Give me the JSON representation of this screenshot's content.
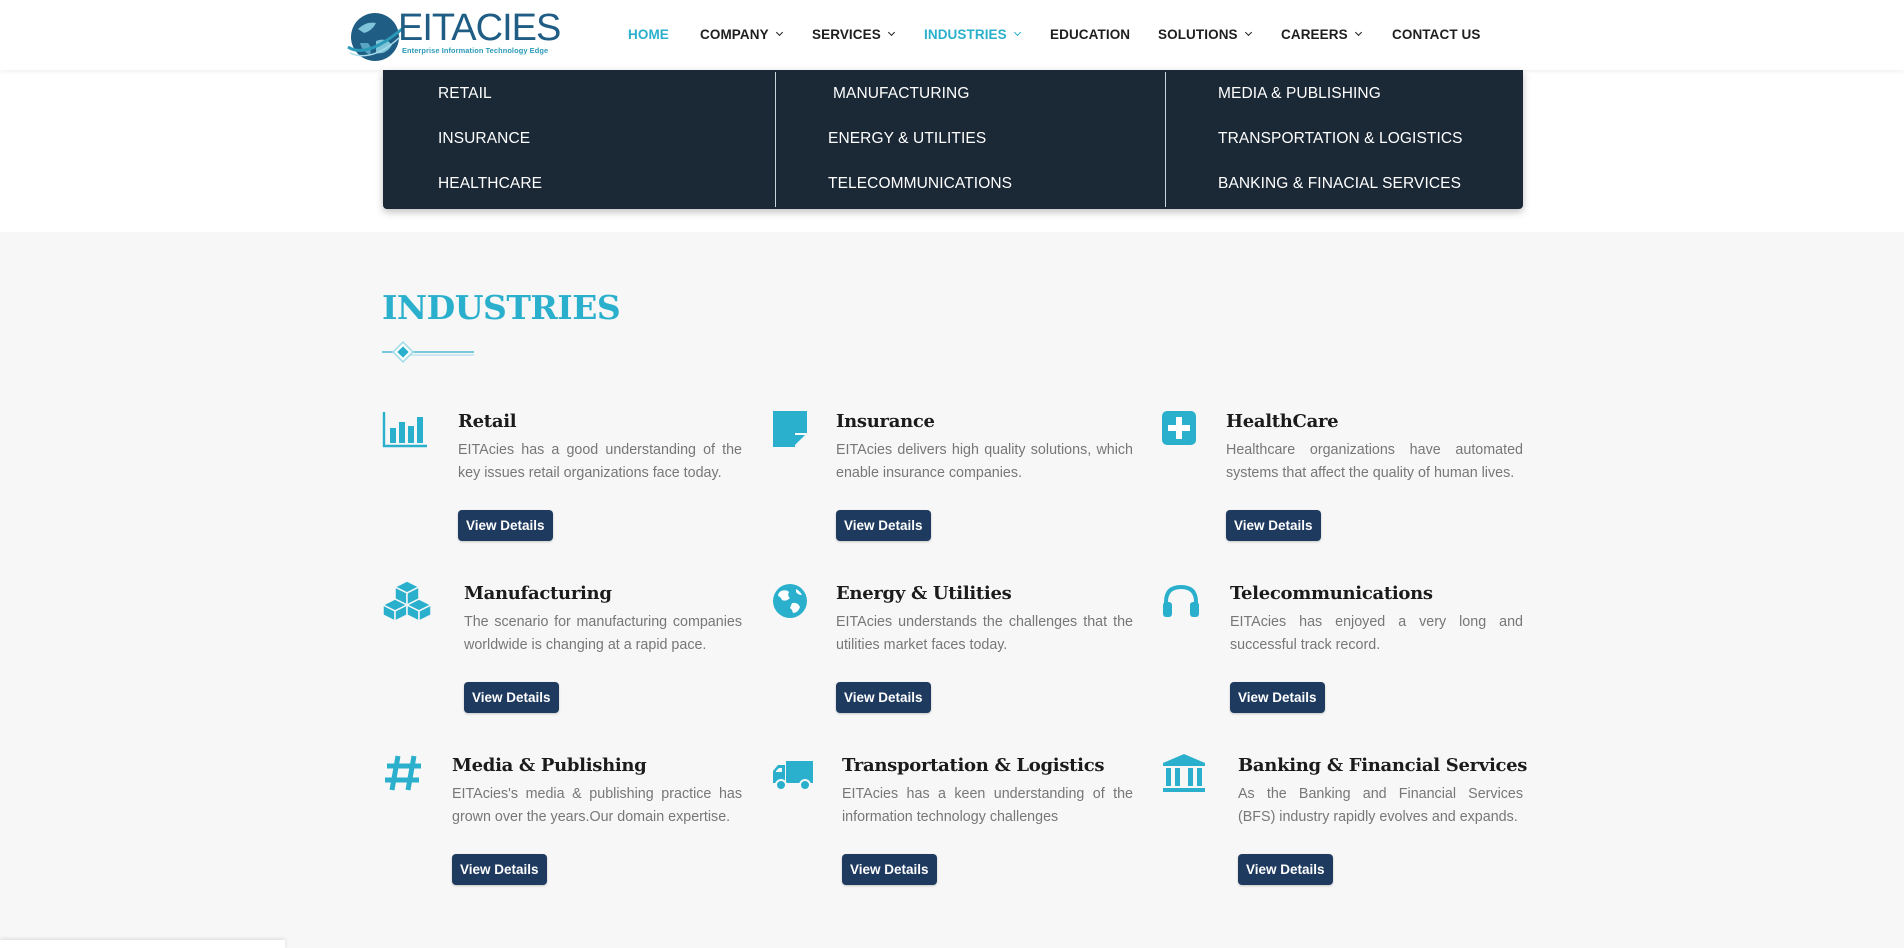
{
  "brand": {
    "name": "EITACIES",
    "tagline": "Enterprise Information Technology Edge",
    "accent_color": "#2ab0cc",
    "navy_color": "#1e3a5f"
  },
  "nav": {
    "items": [
      {
        "label": "HOME",
        "active": true,
        "has_dropdown": false
      },
      {
        "label": "COMPANY",
        "active": false,
        "has_dropdown": true
      },
      {
        "label": "SERVICES",
        "active": false,
        "has_dropdown": true
      },
      {
        "label": "INDUSTRIES",
        "active": false,
        "has_dropdown": true
      },
      {
        "label": "EDUCATION",
        "active": false,
        "has_dropdown": false
      },
      {
        "label": "SOLUTIONS",
        "active": false,
        "has_dropdown": true
      },
      {
        "label": "CAREERS",
        "active": false,
        "has_dropdown": true
      },
      {
        "label": "CONTACT US",
        "active": false,
        "has_dropdown": false
      }
    ]
  },
  "dropdown": {
    "columns": [
      [
        "RETAIL",
        "INSURANCE",
        "HEALTHCARE"
      ],
      [
        "MANUFACTURING",
        "ENERGY & UTILITIES",
        "TELECOMMUNICATIONS"
      ],
      [
        "MEDIA & PUBLISHING",
        "TRANSPORTATION & LOGISTICS",
        "BANKING & FINACIAL SERVICES"
      ]
    ]
  },
  "industries": {
    "title": "INDUSTRIES",
    "button_label": "View Details",
    "cards": [
      {
        "title": "Retail",
        "desc": "EITAcies has a good understanding of the key issues retail organizations face today.",
        "icon": "bar-chart-icon"
      },
      {
        "title": "Insurance",
        "desc": "EITAcies delivers high quality solutions, which enable insurance companies.",
        "icon": "sticky-note-icon"
      },
      {
        "title": "HealthCare",
        "desc": "Healthcare organizations have automated systems that affect the quality of human lives.",
        "icon": "medical-plus-icon"
      },
      {
        "title": "Manufacturing",
        "desc": "The scenario for manufacturing companies worldwide is changing at a rapid pace.",
        "icon": "cubes-icon"
      },
      {
        "title": "Energy & Utilities",
        "desc": "EITAcies understands the challenges that the utilities market faces today.",
        "icon": "globe-icon"
      },
      {
        "title": "Telecommunications",
        "desc": "EITAcies has enjoyed a very long and successful track record.",
        "icon": "headphones-icon"
      },
      {
        "title": "Media & Publishing",
        "desc": "EITAcies's media & publishing practice has grown over the years.Our domain expertise.",
        "icon": "hashtag-icon"
      },
      {
        "title": "Transportation & Logistics",
        "desc": "EITAcies has a keen understanding of the information technology challenges",
        "icon": "truck-icon"
      },
      {
        "title": "Banking & Financial Services",
        "desc": "As the Banking and Financial Services (BFS) industry rapidly evolves and expands.",
        "icon": "bank-icon"
      }
    ]
  }
}
